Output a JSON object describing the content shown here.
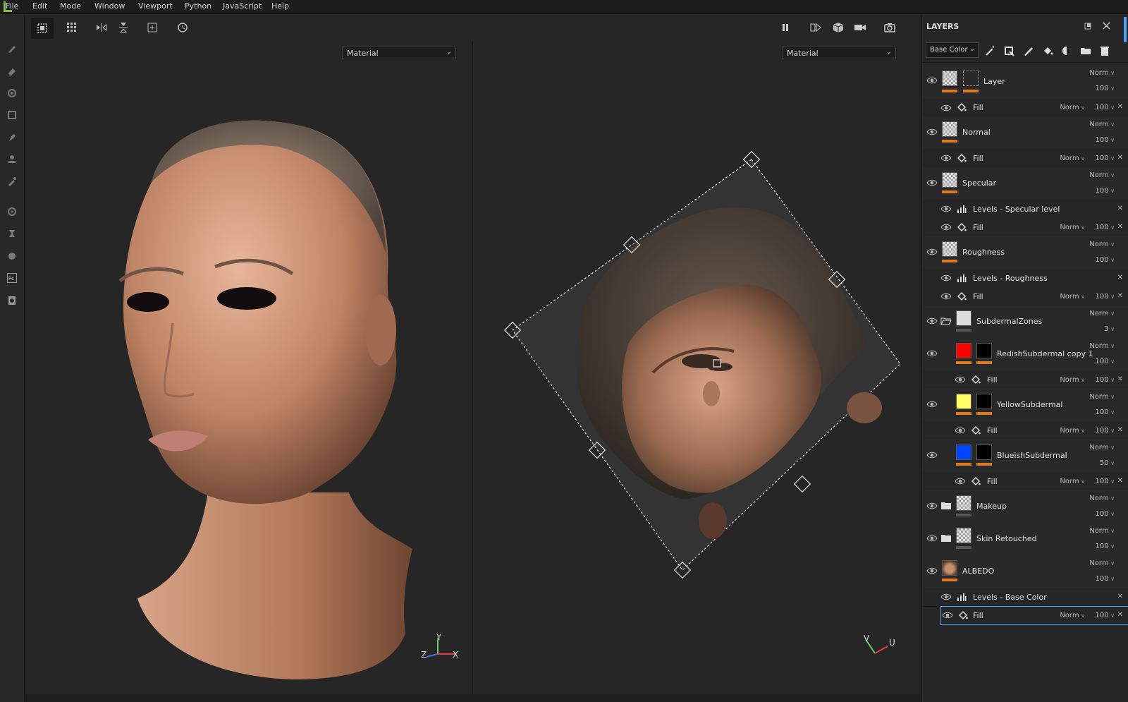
{
  "menubar": {
    "items": [
      "File",
      "Edit",
      "Mode",
      "Window",
      "Viewport",
      "Python",
      "JavaScript",
      "Help"
    ]
  },
  "toolbar": {
    "left_icons": [
      "polygon-fill-icon",
      "grid-icon",
      "symmetry-x-icon",
      "symmetry-y-icon",
      "add-icon",
      "history-icon"
    ],
    "right_icons": [
      "pause-icon",
      "split-view-icon",
      "cube-icon",
      "camera-icon",
      "screenshot-icon"
    ]
  },
  "tools": [
    "brush-icon",
    "eraser-icon",
    "projection-icon",
    "polygon-icon",
    "smudge-icon",
    "clone-stamp-icon",
    "color-picker-icon",
    "bake-icon",
    "physics-icon",
    "material-icon",
    "photoshop-icon",
    "export-icon"
  ],
  "viewports": {
    "left": {
      "mode": "Material",
      "axes": {
        "y": "Y",
        "z": "Z",
        "x": "X"
      }
    },
    "right": {
      "mode": "Material",
      "axes": {
        "v": "V",
        "u": "U"
      }
    }
  },
  "layers_panel": {
    "title": "LAYERS",
    "channel": "Base Color",
    "rows": [
      {
        "name": "Layer",
        "blend": "Norm",
        "opacity": "100"
      },
      {
        "name": "Fill",
        "blend": "Norm",
        "opacity": "100"
      },
      {
        "name": "Normal",
        "blend": "Norm",
        "opacity": "100"
      },
      {
        "name": "Fill",
        "blend": "Norm",
        "opacity": "100"
      },
      {
        "name": "Specular",
        "blend": "Norm",
        "opacity": "100"
      },
      {
        "name": "Levels - Specular level"
      },
      {
        "name": "Fill",
        "blend": "Norm",
        "opacity": "100"
      },
      {
        "name": "Roughness",
        "blend": "Norm",
        "opacity": "100"
      },
      {
        "name": "Levels - Roughness"
      },
      {
        "name": "Fill",
        "blend": "Norm",
        "opacity": "100"
      },
      {
        "name": "SubdermalZones",
        "blend": "Norm",
        "opacity": "3"
      },
      {
        "name": "RedishSubdermal copy 1",
        "blend": "Norm",
        "opacity": "100"
      },
      {
        "name": "Fill",
        "blend": "Norm",
        "opacity": "100"
      },
      {
        "name": "YellowSubdermal",
        "blend": "Norm",
        "opacity": "100"
      },
      {
        "name": "Fill",
        "blend": "Norm",
        "opacity": "100"
      },
      {
        "name": "BlueishSubdermal",
        "blend": "Norm",
        "opacity": "50"
      },
      {
        "name": "Fill",
        "blend": "Norm",
        "opacity": "100"
      },
      {
        "name": "Makeup",
        "blend": "Norm",
        "opacity": "100"
      },
      {
        "name": "Skin Retouched",
        "blend": "Norm",
        "opacity": "100"
      },
      {
        "name": "ALBEDO",
        "blend": "Norm",
        "opacity": "100"
      },
      {
        "name": "Levels - Base Color"
      },
      {
        "name": "Fill",
        "blend": "Norm",
        "opacity": "100"
      }
    ],
    "swatch_colors": {
      "red": "#ff0000",
      "yellow": "#ffff66",
      "blue": "#0044ff",
      "accent": "#e07a1f"
    }
  }
}
